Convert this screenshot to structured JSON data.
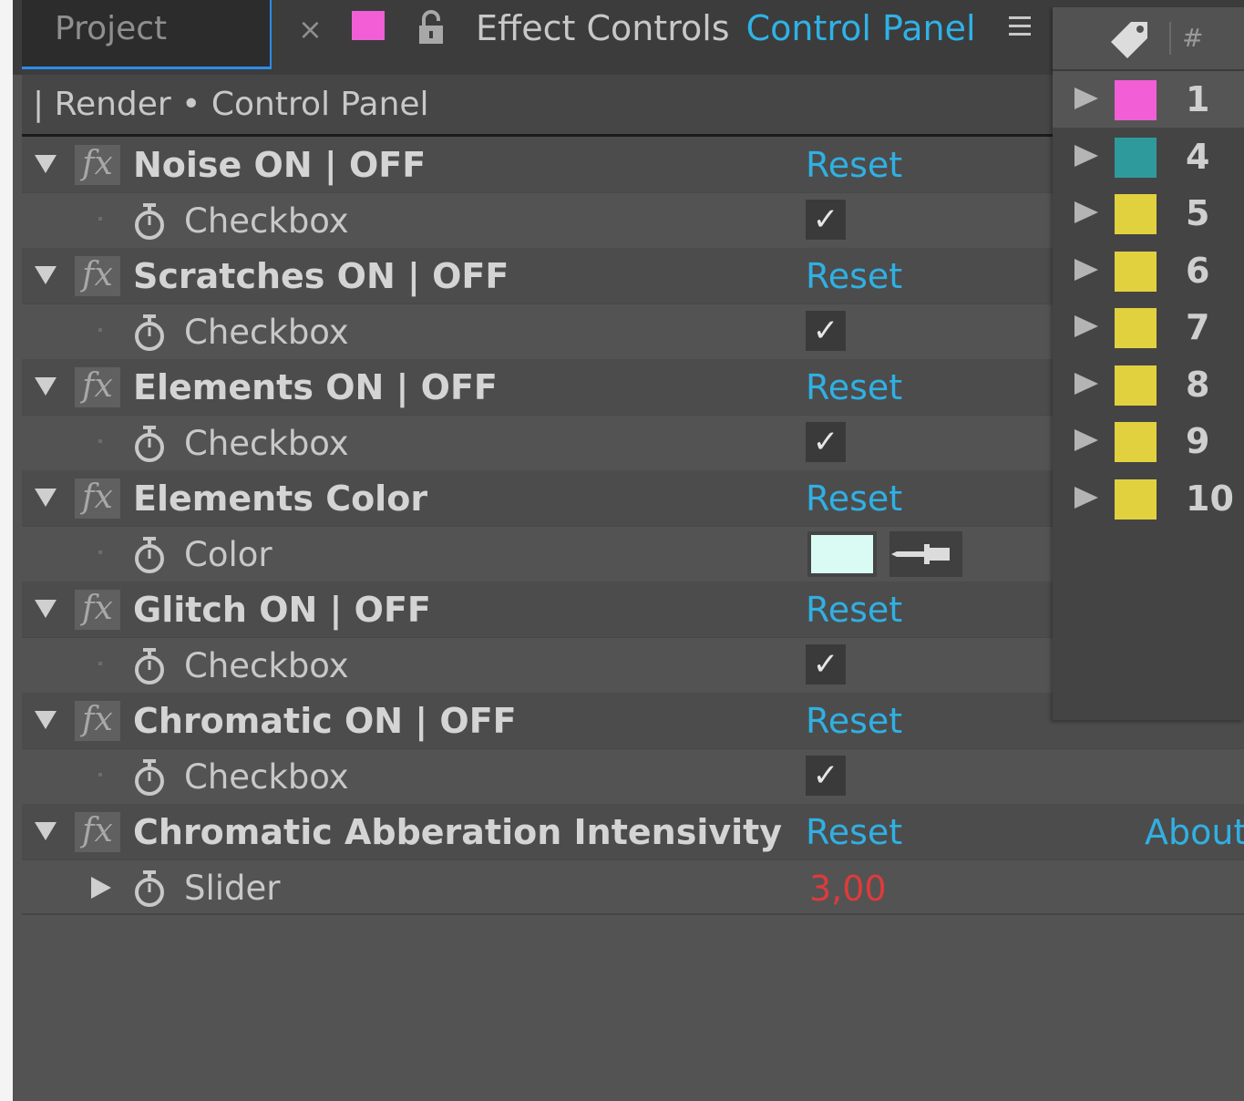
{
  "tabs": {
    "project_label": "Project",
    "close_glyph": "×",
    "label_color": "#f15ed6",
    "title": "Effect Controls",
    "subtitle": "Control Panel",
    "menu_icon": "hamburger-menu-icon"
  },
  "breadcrumb": "| Render • Control Panel",
  "effects": [
    {
      "name": "Noise ON | OFF",
      "reset": "Reset",
      "param": {
        "name": "Checkbox",
        "type": "checkbox",
        "checked": true,
        "check_glyph": "✓"
      }
    },
    {
      "name": "Scratches ON | OFF",
      "reset": "Reset",
      "param": {
        "name": "Checkbox",
        "type": "checkbox",
        "checked": true,
        "check_glyph": "✓"
      }
    },
    {
      "name": "Elements ON | OFF",
      "reset": "Reset",
      "param": {
        "name": "Checkbox",
        "type": "checkbox",
        "checked": true,
        "check_glyph": "✓"
      }
    },
    {
      "name": "Elements Color",
      "reset": "Reset",
      "param": {
        "name": "Color",
        "type": "color",
        "color": "#d9fbf3"
      }
    },
    {
      "name": "Glitch ON | OFF",
      "reset": "Reset",
      "param": {
        "name": "Checkbox",
        "type": "checkbox",
        "checked": true,
        "check_glyph": "✓"
      }
    },
    {
      "name": "Chromatic ON | OFF",
      "reset": "Reset",
      "param": {
        "name": "Checkbox",
        "type": "checkbox",
        "checked": true,
        "check_glyph": "✓"
      }
    },
    {
      "name": "Chromatic Abberation Intensivity",
      "reset": "Reset",
      "about": "About",
      "param": {
        "name": "Slider",
        "type": "slider",
        "value": "3,00"
      }
    }
  ],
  "label_dropdown": {
    "header_icon": "label-tag-icon",
    "header_symbol": "#",
    "items": [
      {
        "number": "1",
        "color": "#f15ed6",
        "selected": true
      },
      {
        "number": "4",
        "color": "#2e9a9c",
        "selected": false
      },
      {
        "number": "5",
        "color": "#e2d13f",
        "selected": false
      },
      {
        "number": "6",
        "color": "#e2d13f",
        "selected": false
      },
      {
        "number": "7",
        "color": "#e2d13f",
        "selected": false
      },
      {
        "number": "8",
        "color": "#e2d13f",
        "selected": false
      },
      {
        "number": "9",
        "color": "#e2d13f",
        "selected": false
      },
      {
        "number": "10",
        "color": "#e2d13f",
        "selected": false
      }
    ]
  }
}
